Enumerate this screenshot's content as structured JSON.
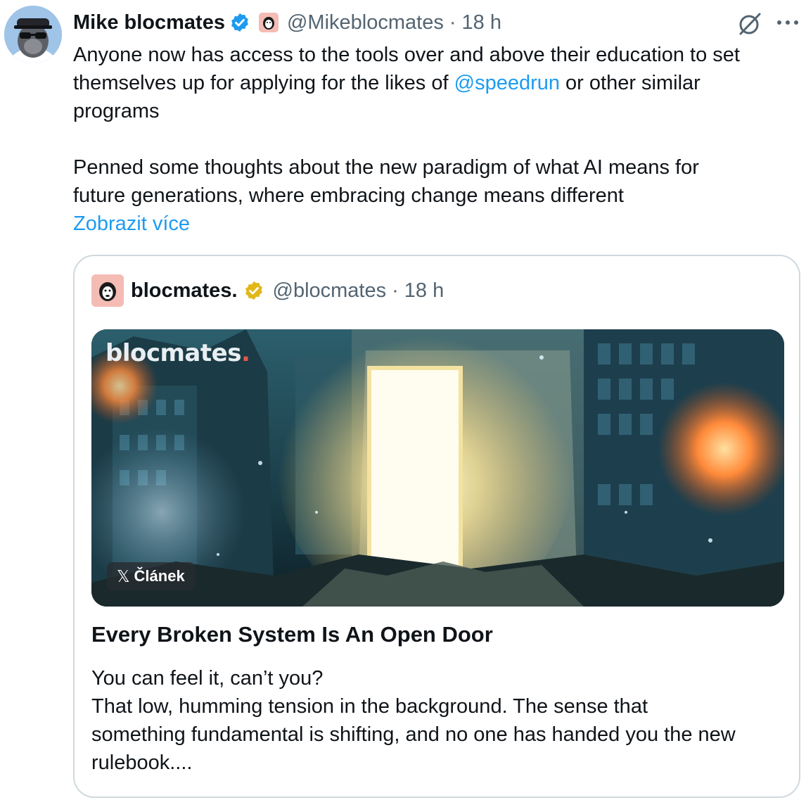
{
  "tweet": {
    "author_name": "Mike blocmates",
    "handle": "@Mikeblocmates",
    "separator": "·",
    "time": "18 h",
    "text_lines": [
      "Anyone now has access to the tools over and above their education to set"
    ],
    "line2_before": "themselves up for applying for the likes of ",
    "mention": "@speedrun",
    "line2_after": " or other similar",
    "line3": "programs",
    "paragraph2_lines": [
      "Penned some thoughts about the new paradigm of what AI means for",
      "future generations, where embracing change means different"
    ],
    "show_more": "Zobrazit více"
  },
  "quote": {
    "author_name": "blocmates.",
    "handle": "@blocmates",
    "separator": "·",
    "time": "18 h",
    "media_brand": "blocmates",
    "media_brand_dot": ".",
    "article_badge_x": "𝕏",
    "article_badge": "Článek",
    "article_title": "Every Broken System Is An Open Door",
    "excerpt_lines": [
      "You can feel it, can’t you?",
      "That low, humming tension in the background. The sense that",
      "something fundamental is shifting, and no one has handed you the new",
      "rulebook...."
    ]
  },
  "icons": {
    "verified": "blue-verified-badge-icon",
    "quote_verified": "gold-verified-badge-icon",
    "grok": "grok-icon",
    "more": "more-options-icon"
  },
  "colors": {
    "link": "#1d9bf0",
    "secondary_text": "#536471",
    "verified_blue": "#1d9bf0",
    "verified_gold": "#e2b719",
    "border": "#cfd9de"
  }
}
